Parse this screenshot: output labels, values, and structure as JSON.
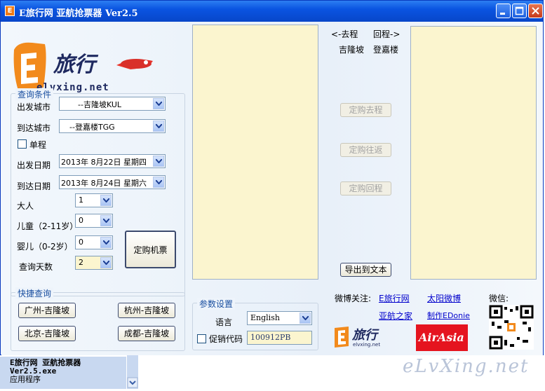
{
  "window": {
    "title": "E旅行网  亚航抢票器  Ver2.5"
  },
  "logo": {
    "text": "旅行",
    "subtext": "elvxing.net"
  },
  "query": {
    "legend": "查询条件",
    "depart_city_label": "出发城市",
    "depart_city_value": "--吉隆坡KUL",
    "arrive_city_label": "到达城市",
    "arrive_city_value": "--登嘉楼TGG",
    "oneway_label": "单程",
    "depart_date_label": "出发日期",
    "depart_date_value": "2013年  8月22日  星期四",
    "arrive_date_label": "到达日期",
    "arrive_date_value": "2013年  8月24日  星期六",
    "adult_label": "大人",
    "adult_value": "1",
    "child_label": "儿童（2-11岁）",
    "child_value": "0",
    "infant_label": "婴儿（0-2岁）",
    "infant_value": "0",
    "days_label": "查询天数",
    "days_value": "2",
    "book_button": "定购机票"
  },
  "quick": {
    "legend": "快捷查询",
    "buttons": [
      "广州-吉隆坡",
      "杭州-吉隆坡",
      "北京-吉隆坡",
      "成都-吉隆坡"
    ]
  },
  "route": {
    "outbound_label": "<-去程",
    "return_label": "回程->",
    "outbound_city": "吉隆坡",
    "return_city": "登嘉楼"
  },
  "middle_buttons": {
    "book_outbound": "定购去程",
    "book_roundtrip": "定购往返",
    "book_return": "定购回程",
    "export": "导出到文本"
  },
  "settings": {
    "legend": "参数设置",
    "language_label": "语言",
    "language_value": "English",
    "promo_label": "促销代码",
    "promo_value": "100912PB"
  },
  "weibo": {
    "label": "微博关注:",
    "links": [
      "E旅行网",
      "太阳微博",
      "亚航之家",
      "制作EDonie"
    ],
    "wechat_label": "微信:"
  },
  "brands": {
    "small_logo": "旅行",
    "small_logo_sub": "elvxing.net",
    "airasia": "AirAsia"
  },
  "watermark": "eLvXing.net",
  "taskbar": {
    "line1": "E旅行网 亚航抢票器",
    "line2": "Ver2.5.exe",
    "line3": "应用程序"
  }
}
